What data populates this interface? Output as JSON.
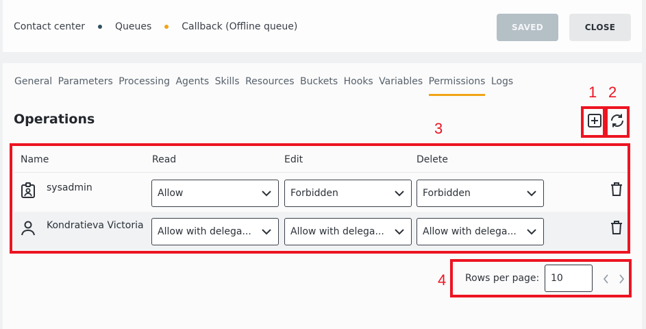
{
  "breadcrumb": {
    "items": [
      "Contact center",
      "Queues",
      "Callback (Offline queue)"
    ],
    "dot_colors": [
      "#2f4f5f",
      "#f1a415"
    ]
  },
  "header": {
    "saved_label": "SAVED",
    "close_label": "CLOSE"
  },
  "tabs": [
    {
      "label": "General"
    },
    {
      "label": "Parameters"
    },
    {
      "label": "Processing"
    },
    {
      "label": "Agents"
    },
    {
      "label": "Skills"
    },
    {
      "label": "Resources"
    },
    {
      "label": "Buckets"
    },
    {
      "label": "Hooks"
    },
    {
      "label": "Variables"
    },
    {
      "label": "Permissions",
      "active": true
    },
    {
      "label": "Logs"
    }
  ],
  "operations": {
    "title": "Operations",
    "add_icon": "plus-square-icon",
    "refresh_icon": "refresh-icon"
  },
  "table": {
    "columns": [
      "Name",
      "Read",
      "Edit",
      "Delete"
    ],
    "rows": [
      {
        "name": "sysadmin",
        "icon": "badge-icon",
        "read": "Allow",
        "edit": "Forbidden",
        "delete": "Forbidden"
      },
      {
        "name": "Kondratieva Victoria",
        "icon": "user-icon",
        "read": "Allow with delega...",
        "edit": "Allow with delega...",
        "delete": "Allow with delega..."
      }
    ]
  },
  "pagination": {
    "rows_per_page_label": "Rows per page:",
    "rows_per_page_value": "10"
  },
  "annotations": {
    "labels": [
      "1",
      "2",
      "3",
      "4"
    ],
    "color": "#ed1421"
  },
  "colors": {
    "accent": "#f1a415",
    "annotation": "#ed1421"
  }
}
